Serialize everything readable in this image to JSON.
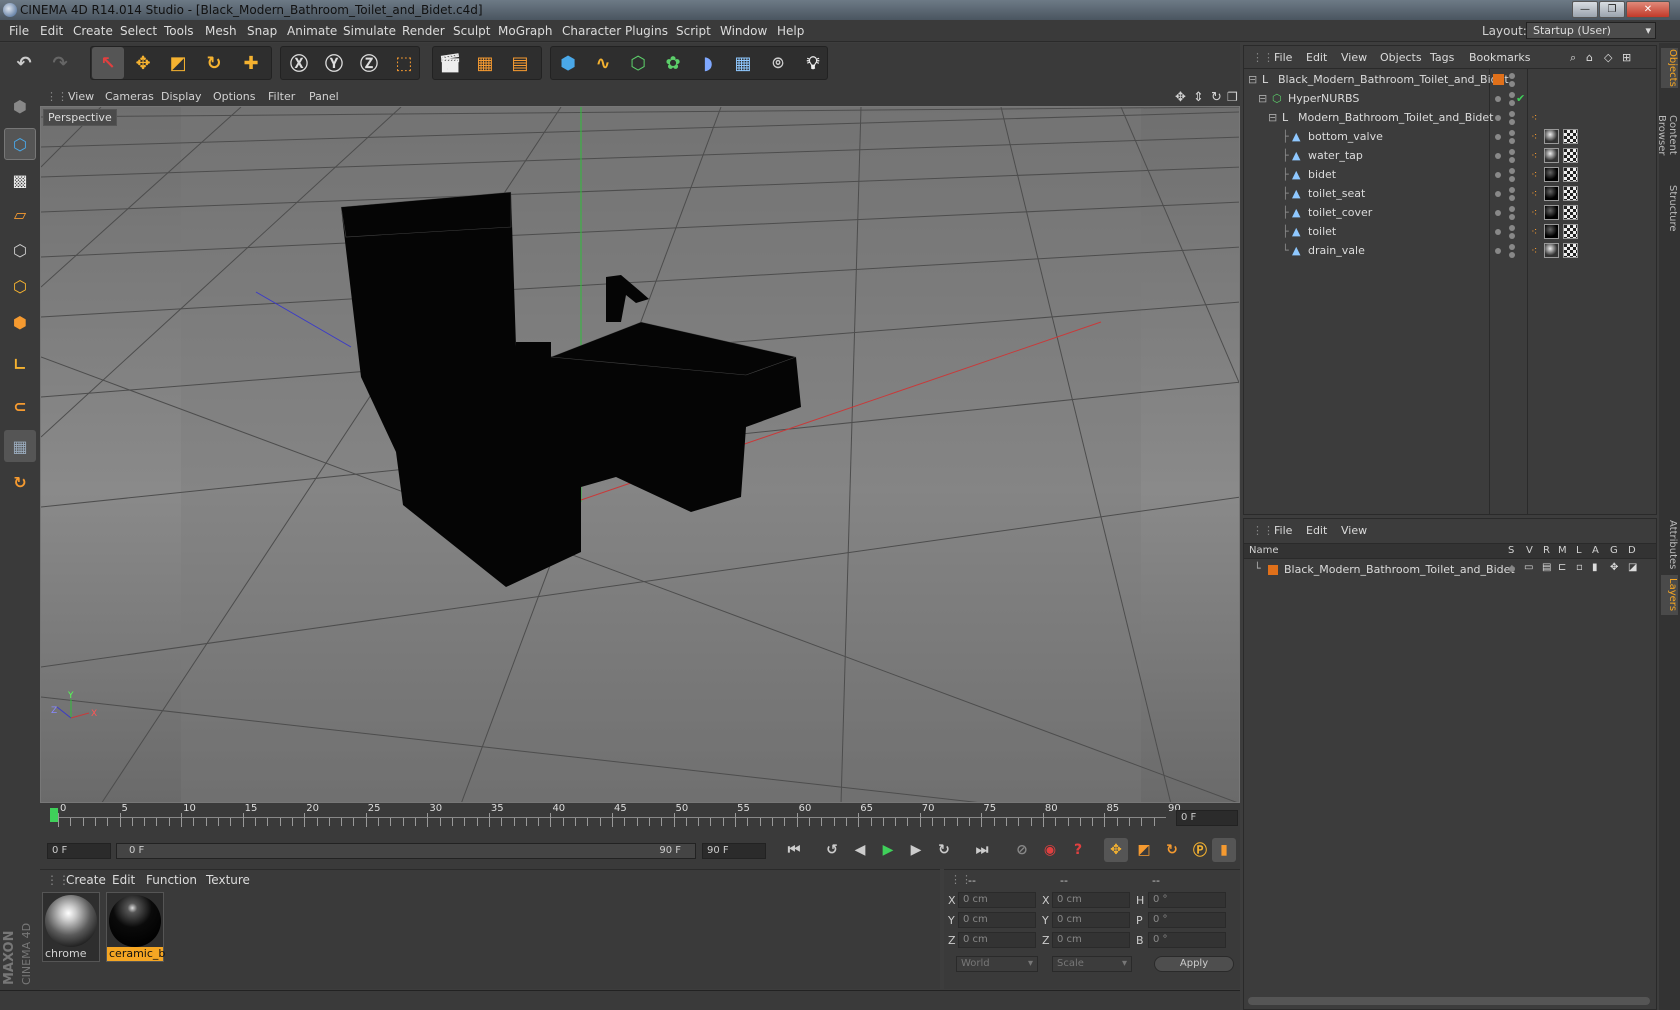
{
  "window": {
    "title": "CINEMA 4D R14.014 Studio - [Black_Modern_Bathroom_Toilet_and_Bidet.c4d]",
    "controls": [
      "—",
      "❐",
      "✕"
    ]
  },
  "menubar": {
    "items": [
      "File",
      "Edit",
      "Create",
      "Select",
      "Tools",
      "Mesh",
      "Snap",
      "Animate",
      "Simulate",
      "Render",
      "Sculpt",
      "MoGraph",
      "Character",
      "Plugins",
      "Script",
      "Window",
      "Help"
    ],
    "layout_label": "Layout:",
    "layout_value": "Startup (User)"
  },
  "viewport": {
    "menu": [
      "View",
      "Cameras",
      "Display",
      "Options",
      "Filter",
      "Panel"
    ],
    "label": "Perspective",
    "axis_x": "X",
    "axis_y": "Y",
    "axis_z": "Z"
  },
  "timeline": {
    "ticks": [
      "0",
      "5",
      "10",
      "15",
      "20",
      "25",
      "30",
      "35",
      "40",
      "45",
      "50",
      "55",
      "60",
      "65",
      "70",
      "75",
      "80",
      "85",
      "90"
    ],
    "current_frame": "0 F"
  },
  "controls": {
    "start_field": "0 F",
    "range_start": "0 F",
    "range_end": "90 F",
    "end_field": "90 F"
  },
  "material_manager": {
    "menu": [
      "Create",
      "Edit",
      "Function",
      "Texture"
    ],
    "materials": [
      {
        "name": "chrome",
        "selected": false
      },
      {
        "name": "ceramic_b",
        "selected": true
      }
    ]
  },
  "coordinates": {
    "headers": [
      "--",
      "--",
      "--"
    ],
    "rows": [
      {
        "pos_label": "X",
        "pos": "0 cm",
        "size_label": "X",
        "size": "0 cm",
        "rot_label": "H",
        "rot": "0 °"
      },
      {
        "pos_label": "Y",
        "pos": "0 cm",
        "size_label": "Y",
        "size": "0 cm",
        "rot_label": "P",
        "rot": "0 °"
      },
      {
        "pos_label": "Z",
        "pos": "0 cm",
        "size_label": "Z",
        "size": "0 cm",
        "rot_label": "B",
        "rot": "0 °"
      }
    ],
    "mode_world": "World",
    "mode_scale": "Scale",
    "apply": "Apply"
  },
  "object_manager": {
    "menu": [
      "File",
      "Edit",
      "View",
      "Objects",
      "Tags",
      "Bookmarks"
    ],
    "objects": [
      {
        "name": "Black_Modern_Bathroom_Toilet_and_Bidet",
        "icon": "null-object-icon"
      },
      {
        "name": "HyperNURBS",
        "icon": "hypernurbs-icon"
      },
      {
        "name": "Modern_Bathroom_Toilet_and_Bidet",
        "icon": "null-object-icon"
      },
      {
        "name": "bottom_valve",
        "icon": "polygon-object-icon"
      },
      {
        "name": "water_tap",
        "icon": "polygon-object-icon"
      },
      {
        "name": "bidet",
        "icon": "polygon-object-icon"
      },
      {
        "name": "toilet_seat",
        "icon": "polygon-object-icon"
      },
      {
        "name": "toilet_cover",
        "icon": "polygon-object-icon"
      },
      {
        "name": "toilet",
        "icon": "polygon-object-icon"
      },
      {
        "name": "drain_vale",
        "icon": "polygon-object-icon"
      }
    ]
  },
  "layer_manager": {
    "menu": [
      "File",
      "Edit",
      "View"
    ],
    "columns": [
      "Name",
      "S",
      "V",
      "R",
      "M",
      "L",
      "A",
      "G",
      "D"
    ],
    "layers": [
      {
        "name": "Black_Modern_Bathroom_Toilet_and_Bidet",
        "color": "#e0701a"
      }
    ]
  },
  "side_tabs": [
    "Objects",
    "Content Browser",
    "Structure",
    "Attributes",
    "Layers"
  ],
  "branding": {
    "line1": "MAXON",
    "line2": "CINEMA 4D"
  },
  "colors": {
    "accent": "#f5a623",
    "selected": "#f5a623"
  }
}
